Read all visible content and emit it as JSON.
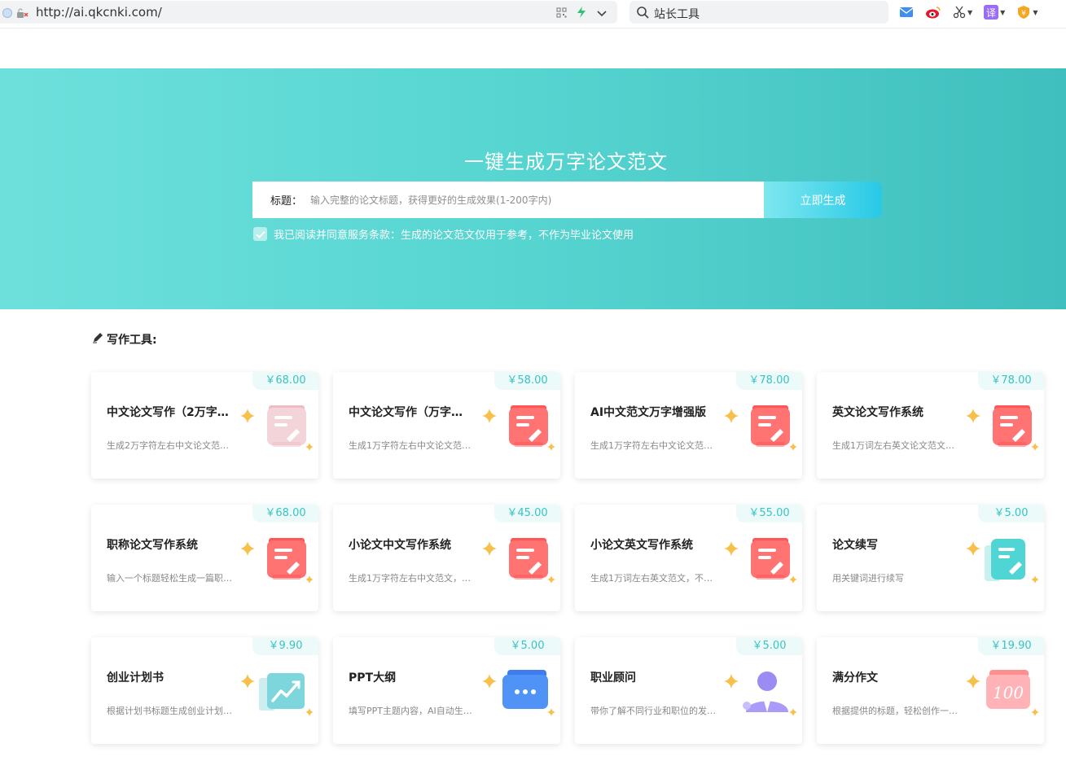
{
  "browser": {
    "url": "http://ai.qkcnki.com/",
    "search_text": "站长工具"
  },
  "hero": {
    "title": "一键生成万字论文范文",
    "input_label": "标题：",
    "input_placeholder": "输入完整的论文标题，获得更好的生成效果(1-200字内)",
    "button_label": "立即生成",
    "agree_text": "我已阅读并同意服务条款：生成的论文范文仅用于参考，不作为毕业论文使用"
  },
  "section": {
    "title": "写作工具:"
  },
  "tools": [
    {
      "title": "中文论文写作（2万字…",
      "desc": "生成2万字符左右中文论文范…",
      "price": "￥68.00",
      "icon": "document-edit-icon-pale"
    },
    {
      "title": "中文论文写作（万字…",
      "desc": "生成1万字符左右中文论文范…",
      "price": "￥58.00",
      "icon": "document-edit-icon"
    },
    {
      "title": "AI中文范文万字增强版",
      "desc": "生成1万字符左右中文论文范…",
      "price": "￥78.00",
      "icon": "document-edit-icon"
    },
    {
      "title": "英文论文写作系统",
      "desc": "生成1万词左右英文论文范文…",
      "price": "￥78.00",
      "icon": "document-edit-icon"
    },
    {
      "title": "职称论文写作系统",
      "desc": "输入一个标题轻松生成一篇职…",
      "price": "￥68.00",
      "icon": "document-edit-icon"
    },
    {
      "title": "小论文中文写作系统",
      "desc": "生成1万字符左右中文范文，…",
      "price": "￥45.00",
      "icon": "document-edit-icon"
    },
    {
      "title": "小论文英文写作系统",
      "desc": "生成1万词左右英文范文，不…",
      "price": "￥55.00",
      "icon": "document-edit-icon"
    },
    {
      "title": "论文续写",
      "desc": "用关键词进行续写",
      "price": "￥5.00",
      "icon": "document-continue-icon"
    },
    {
      "title": "创业计划书",
      "desc": "根据计划书标题生成创业计划…",
      "price": "￥9.90",
      "icon": "growth-chart-icon"
    },
    {
      "title": "PPT大纲",
      "desc": "填写PPT主题内容，AI自动生…",
      "price": "￥5.00",
      "icon": "slides-icon"
    },
    {
      "title": "职业顾问",
      "desc": "带你了解不同行业和职位的发…",
      "price": "￥5.00",
      "icon": "consultant-icon"
    },
    {
      "title": "满分作文",
      "desc": "根据提供的标题，轻松创作一…",
      "price": "￥19.90",
      "icon": "score-100-icon"
    }
  ]
}
